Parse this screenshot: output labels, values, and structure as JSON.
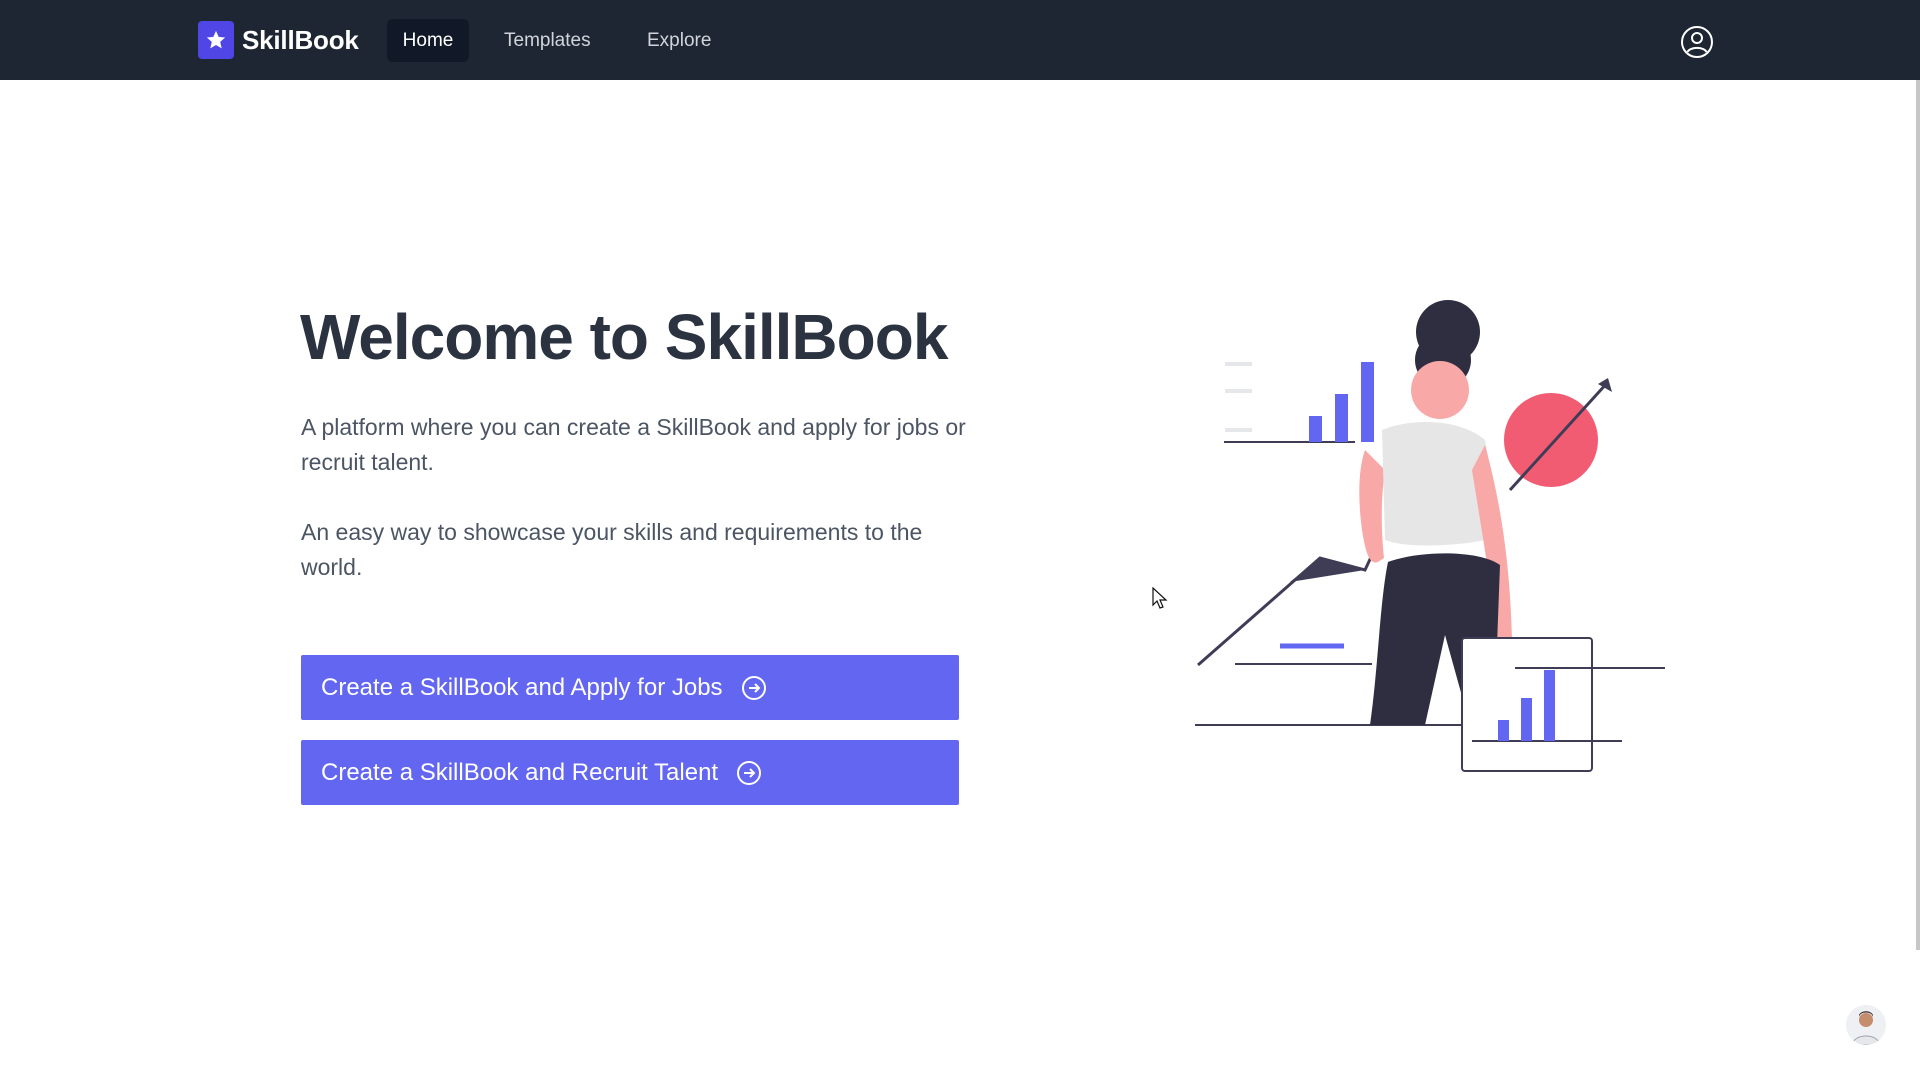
{
  "brand": {
    "name": "SkillBook",
    "logo_icon": "star-icon",
    "logo_color": "#4f46e5"
  },
  "nav": {
    "items": [
      {
        "label": "Home",
        "active": true
      },
      {
        "label": "Templates",
        "active": false
      },
      {
        "label": "Explore",
        "active": false
      }
    ],
    "user_icon": "user-circle-icon"
  },
  "hero": {
    "title": "Welcome to SkillBook",
    "paragraph_1": "A platform where you can create a SkillBook and apply for jobs or recruit talent.",
    "paragraph_2": "An easy way to showcase your skills and requirements to the world.",
    "buttons": [
      {
        "label": "Create a SkillBook and Apply for Jobs",
        "icon": "arrow-circle-right-icon"
      },
      {
        "label": "Create a SkillBook and Recruit Talent",
        "icon": "arrow-circle-right-icon"
      }
    ]
  },
  "colors": {
    "navbar_bg": "#1e2633",
    "accent": "#6366f1",
    "illustration_circle": "#f25c73",
    "title_text": "#2b3240"
  },
  "illustration": {
    "name": "woman-with-charts-illustration"
  }
}
